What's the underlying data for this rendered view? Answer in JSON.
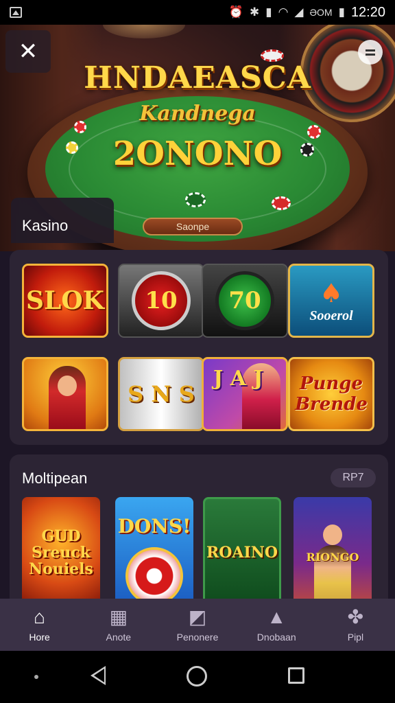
{
  "status_bar": {
    "time": "12:20",
    "carrier": "ƏOM",
    "icons": [
      "image-icon",
      "alarm-icon",
      "bluetooth-icon",
      "vibrate-icon",
      "wifi-icon",
      "signal-icon",
      "battery-icon"
    ]
  },
  "hero": {
    "title": "HNDAEASCA",
    "subtitle": "Kandnega",
    "number": "2ONONO",
    "pill_label": "Saonpe",
    "close_icon": "close-icon",
    "menu_icon": "menu-icon"
  },
  "casino": {
    "tab_label": "Kasino",
    "tiles": [
      {
        "text": "SLOK"
      },
      {
        "text": "10"
      },
      {
        "text": "70"
      },
      {
        "text": "Sooerol"
      },
      {
        "text": ""
      },
      {
        "text": "S N S"
      },
      {
        "text": "J A J"
      },
      {
        "text": "Punge Brende"
      }
    ]
  },
  "multi": {
    "title": "Moltipean",
    "badge": "RP7",
    "games": [
      {
        "text": "GUD Sreuck Nouiels"
      },
      {
        "text": "DONS!"
      },
      {
        "text": "ROAINO"
      },
      {
        "text": "RIONGO"
      }
    ]
  },
  "bottom_nav": {
    "items": [
      {
        "label": "Hore",
        "icon": "home-icon",
        "active": true
      },
      {
        "label": "Anote",
        "icon": "calendar-icon",
        "active": false
      },
      {
        "label": "Penonere",
        "icon": "image-edit-icon",
        "active": false
      },
      {
        "label": "Dnobaan",
        "icon": "bell-icon",
        "active": false
      },
      {
        "label": "Pipl",
        "icon": "people-icon",
        "active": false
      }
    ]
  },
  "colors": {
    "background": "#1d1626",
    "card": "#2c2434",
    "nav": "#3a3146",
    "gold": "#ffd84a",
    "felt": "#2a8a34"
  }
}
